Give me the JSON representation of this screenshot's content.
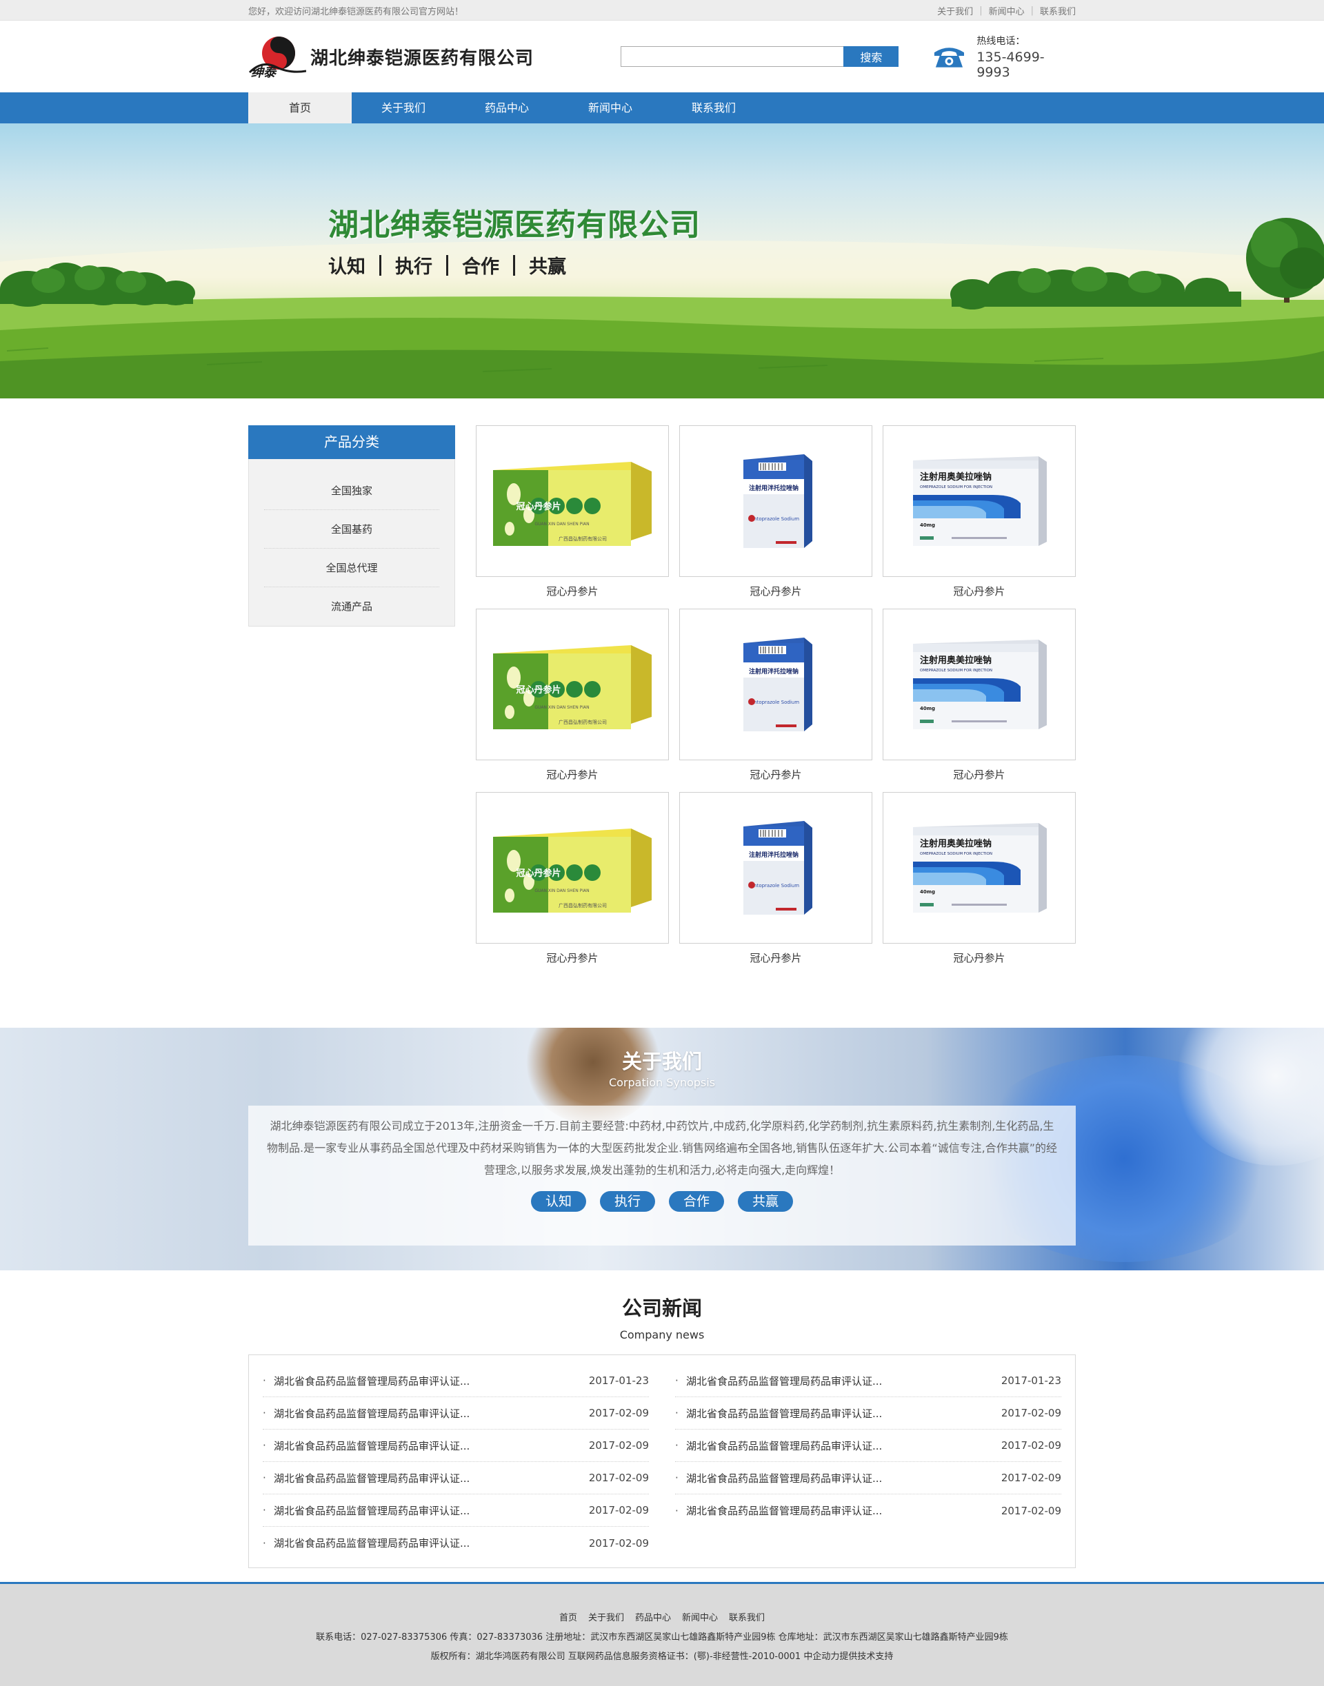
{
  "topbar": {
    "welcome": "您好，欢迎访问湖北绅泰铠源医药有限公司官方网站！",
    "links": [
      "关于我们",
      "新闻中心",
      "联系我们"
    ]
  },
  "header": {
    "logo_text": "湖北绅泰铠源医药有限公司",
    "logo_mark_text": "绅泰",
    "search_placeholder": "",
    "search_button": "搜索",
    "hotline_label": "热线电话：",
    "hotline_number": "135-4699-9993"
  },
  "nav": {
    "items": [
      "首页",
      "关于我们",
      "药品中心",
      "新闻中心",
      "联系我们"
    ],
    "active_index": 0
  },
  "banner": {
    "title": "湖北绅泰铠源医药有限公司",
    "slogan": [
      "认知",
      "执行",
      "合作",
      "共赢"
    ]
  },
  "sidebar": {
    "title": "产品分类",
    "categories": [
      "全国独家",
      "全国基药",
      "全国总代理",
      "流通产品"
    ]
  },
  "products": [
    {
      "name": "冠心丹参片",
      "image": "green-box"
    },
    {
      "name": "冠心丹参片",
      "image": "blue-box"
    },
    {
      "name": "冠心丹参片",
      "image": "white-box"
    },
    {
      "name": "冠心丹参片",
      "image": "green-box"
    },
    {
      "name": "冠心丹参片",
      "image": "blue-box"
    },
    {
      "name": "冠心丹参片",
      "image": "white-box"
    },
    {
      "name": "冠心丹参片",
      "image": "green-box"
    },
    {
      "name": "冠心丹参片",
      "image": "blue-box"
    },
    {
      "name": "冠心丹参片",
      "image": "white-box"
    }
  ],
  "product_box_text": {
    "green_box": {
      "main": "冠心丹参片",
      "pinyin": "GUAN  XIN  DAN  SHEN  PIAN",
      "maker": "广西昌弘制药有限公司"
    },
    "blue_box": {
      "main": "注射用泮托拉唑钠",
      "sub": "Pantoprazole Sodium"
    },
    "white_box": {
      "main": "注射用奥美拉唑钠",
      "sub": "OMEPRAZOLE SODIUM FOR INJECTION",
      "dose": "40mg"
    }
  },
  "about": {
    "title": "关于我们",
    "subtitle": "Corpation Synopsis",
    "text": "湖北绅泰铠源医药有限公司成立于2013年,注册资金一千万.目前主要经营:中药材,中药饮片,中成药,化学原料药,化学药制剂,抗生素原料药,抗生素制剂,生化药品,生物制品.是一家专业从事药品全国总代理及中药材采购销售为一体的大型医药批发企业.销售网络遍布全国各地,销售队伍逐年扩大.公司本着“诚信专注,合作共赢”的经营理念,以服务求发展,焕发出蓬勃的生机和活力,必将走向强大,走向辉煌！",
    "tags": [
      "认知",
      "执行",
      "合作",
      "共赢"
    ]
  },
  "news": {
    "title": "公司新闻",
    "subtitle": "Company news",
    "left": [
      {
        "title": "湖北省食品药品监督管理局药品审评认证...",
        "date": "2017-01-23"
      },
      {
        "title": "湖北省食品药品监督管理局药品审评认证...",
        "date": "2017-02-09"
      },
      {
        "title": "湖北省食品药品监督管理局药品审评认证...",
        "date": "2017-02-09"
      },
      {
        "title": "湖北省食品药品监督管理局药品审评认证...",
        "date": "2017-02-09"
      },
      {
        "title": "湖北省食品药品监督管理局药品审评认证...",
        "date": "2017-02-09"
      },
      {
        "title": "湖北省食品药品监督管理局药品审评认证...",
        "date": "2017-02-09"
      }
    ],
    "right": [
      {
        "title": "湖北省食品药品监督管理局药品审评认证...",
        "date": "2017-01-23"
      },
      {
        "title": "湖北省食品药品监督管理局药品审评认证...",
        "date": "2017-02-09"
      },
      {
        "title": "湖北省食品药品监督管理局药品审评认证...",
        "date": "2017-02-09"
      },
      {
        "title": "湖北省食品药品监督管理局药品审评认证...",
        "date": "2017-02-09"
      },
      {
        "title": "湖北省食品药品监督管理局药品审评认证...",
        "date": "2017-02-09"
      }
    ]
  },
  "footer": {
    "links": [
      "首页",
      "关于我们",
      "药品中心",
      "新闻中心",
      "联系我们"
    ],
    "contact": "联系电话：027-027-83375306 传真：027-83373036 注册地址：武汉市东西湖区吴家山七雄路鑫斯特产业园9栋 仓库地址：武汉市东西湖区吴家山七雄路鑫斯特产业园9栋",
    "copyright": "版权所有：湖北华鸿医药有限公司 互联网药品信息服务资格证书：(鄂)-非经营性-2010-0001 中企动力提供技术支持"
  },
  "colors": {
    "primary": "#2a78bf",
    "banner_title": "#2f8a36",
    "footer_bg": "#dadada"
  }
}
